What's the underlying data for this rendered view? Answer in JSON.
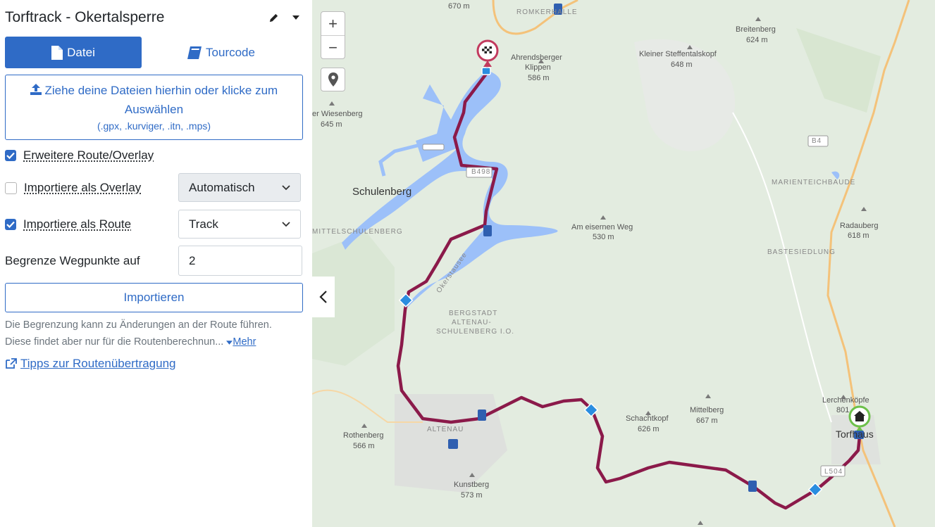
{
  "panel": {
    "title": "Torftrack - Okertalsperre",
    "tabs": [
      {
        "label": "Datei",
        "active": true
      },
      {
        "label": "Tourcode",
        "active": false
      }
    ],
    "dropzone": {
      "main": "Ziehe deine Dateien hierhin oder klicke zum Auswählen",
      "sub": "(.gpx, .kurviger, .itn, .mps)"
    },
    "options": {
      "extended_route_label": "Erweitere Route/Overlay",
      "extended_route_checked": true,
      "overlay_label": "Importiere als Overlay",
      "overlay_checked": false,
      "overlay_select": "Automatisch",
      "route_label": "Importiere als Route",
      "route_checked": true,
      "route_select": "Track",
      "limit_label": "Begrenze Wegpunkte auf",
      "limit_value": "2"
    },
    "import_button": "Importieren",
    "note_line1": "Die Begrenzung kann zu Änderungen an der Route führen.",
    "note_line2": "Diese findet aber nur für die Routenberechnun...",
    "more_link": "Mehr",
    "tips_link": "Tipps zur Routenübertragung"
  },
  "map": {
    "zoom_in": "+",
    "zoom_out": "−",
    "route_color": "#8b1a4a",
    "water_color": "#9cc0f9",
    "labels": [
      {
        "text": "670 m"
      },
      {
        "text": "ROMKERHALLE"
      },
      {
        "text": "Ahrendsberger"
      },
      {
        "text": "Klippen"
      },
      {
        "text": "586 m"
      },
      {
        "text": "Kleiner Steffentalskopf"
      },
      {
        "text": "648 m"
      },
      {
        "text": "Breitenberg"
      },
      {
        "text": "624 m"
      },
      {
        "text": "er Wiesenberg"
      },
      {
        "text": "645 m"
      },
      {
        "text": "Schulenberg"
      },
      {
        "text": "MITTELSCHULENBERG"
      },
      {
        "text": "B498"
      },
      {
        "text": "B4"
      },
      {
        "text": "MARIENTEICHBAUDE"
      },
      {
        "text": "Am eisernen Weg"
      },
      {
        "text": "530 m"
      },
      {
        "text": "Radauberg"
      },
      {
        "text": "618 m"
      },
      {
        "text": "BASTESIEDLUNG"
      },
      {
        "text": "Okerstausee"
      },
      {
        "text": "BERGSTADT"
      },
      {
        "text": "ALTENAU-"
      },
      {
        "text": "SCHULENBERG I.O."
      },
      {
        "text": "Rothenberg"
      },
      {
        "text": "566 m"
      },
      {
        "text": "ALTENAU"
      },
      {
        "text": "Kunstberg"
      },
      {
        "text": "573 m"
      },
      {
        "text": "Schachtkopf"
      },
      {
        "text": "626 m"
      },
      {
        "text": "Mittelberg"
      },
      {
        "text": "667 m"
      },
      {
        "text": "Lerchenköpfe"
      },
      {
        "text": "801"
      },
      {
        "text": "Torfhaus"
      },
      {
        "text": "L504"
      }
    ]
  }
}
